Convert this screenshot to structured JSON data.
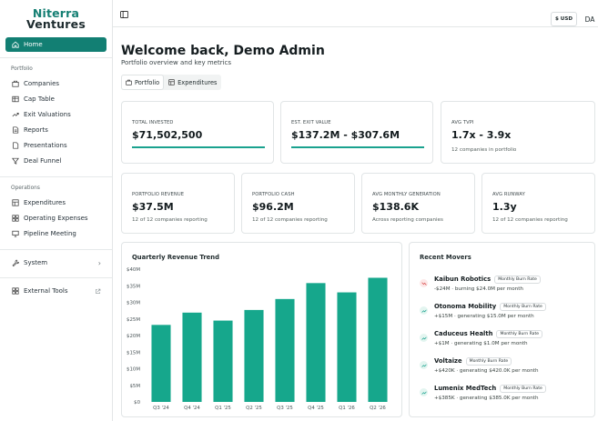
{
  "brand": {
    "line1": "Niterra",
    "line2": "Ventures"
  },
  "sidebar": {
    "home": "Home",
    "portfolio_label": "Portfolio",
    "portfolio_items": [
      "Companies",
      "Cap Table",
      "Exit Valuations",
      "Reports",
      "Presentations",
      "Deal Funnel"
    ],
    "operations_label": "Operations",
    "operations_items": [
      "Expenditures",
      "Operating Expenses",
      "Pipeline Meeting"
    ],
    "system": "System",
    "external_tools": "External Tools"
  },
  "topbar": {
    "currency": "$ USD",
    "avatar": "DA"
  },
  "header": {
    "title": "Welcome back, Demo Admin",
    "subtitle": "Portfolio overview and key metrics"
  },
  "tabs": [
    {
      "label": "Portfolio",
      "active": true
    },
    {
      "label": "Expenditures",
      "active": false
    }
  ],
  "kpis_top": [
    {
      "label": "TOTAL INVESTED",
      "value": "$71,502,500",
      "sub": ""
    },
    {
      "label": "EST. EXIT VALUE",
      "value": "$137.2M - $307.6M",
      "sub": ""
    },
    {
      "label": "AVG TVPI",
      "value": "1.7x - 3.9x",
      "sub": "12 companies in portfolio"
    }
  ],
  "kpis_bottom": [
    {
      "label": "PORTFOLIO REVENUE",
      "value": "$37.5M",
      "sub": "12 of 12 companies reporting"
    },
    {
      "label": "PORTFOLIO CASH",
      "value": "$96.2M",
      "sub": "12 of 12 companies reporting"
    },
    {
      "label": "AVG MONTHLY GENERATION",
      "value": "$138.6K",
      "sub": "Across reporting companies"
    },
    {
      "label": "AVG RUNWAY",
      "value": "1.3y",
      "sub": "12 of 12 companies reporting"
    }
  ],
  "chart_data": {
    "type": "bar",
    "title": "Quarterly Revenue Trend",
    "categories": [
      "Q3 '24",
      "Q4 '24",
      "Q1 '25",
      "Q2 '25",
      "Q3 '25",
      "Q4 '25",
      "Q1 '26",
      "Q2 '26"
    ],
    "values": [
      23.2,
      26.9,
      24.5,
      27.7,
      31.0,
      35.8,
      33.0,
      37.4
    ],
    "yticks": [
      "$40M",
      "$35M",
      "$30M",
      "$25M",
      "$20M",
      "$15M",
      "$10M",
      "$5M",
      "$0"
    ],
    "ylim": [
      0,
      40
    ],
    "color": "#16a78c",
    "grid": false
  },
  "movers": {
    "title": "Recent Movers",
    "items": [
      {
        "name": "Kaibun Robotics",
        "badge": "Monthly Burn Rate",
        "desc": "-$24M · burning $24.0M per month",
        "trend": "down"
      },
      {
        "name": "Otonoma Mobility",
        "badge": "Monthly Burn Rate",
        "desc": "+$15M · generating $15.0M per month",
        "trend": "up"
      },
      {
        "name": "Caduceus Health",
        "badge": "Monthly Burn Rate",
        "desc": "+$1M · generating $1.0M per month",
        "trend": "up"
      },
      {
        "name": "Voltaize",
        "badge": "Monthly Burn Rate",
        "desc": "+$420K · generating $420.0K per month",
        "trend": "up"
      },
      {
        "name": "Lumenix MedTech",
        "badge": "Monthly Burn Rate",
        "desc": "+$385K · generating $385.0K per month",
        "trend": "up"
      }
    ]
  },
  "colors": {
    "accent": "#127f73",
    "bar": "#16a78c",
    "down": "#d64545",
    "up": "#1aa28f"
  }
}
